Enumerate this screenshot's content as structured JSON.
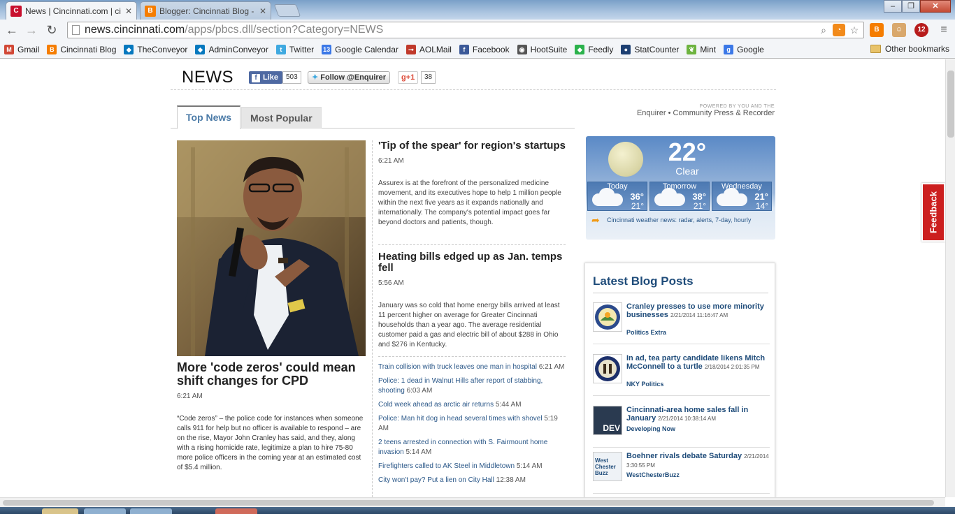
{
  "browser": {
    "tabs": [
      {
        "label": "News | Cincinnati.com | ci",
        "active": true,
        "icon": "C"
      },
      {
        "label": "Blogger: Cincinnati Blog -",
        "active": false,
        "icon": "B"
      }
    ],
    "url_host": "news.cincinnati.com",
    "url_path": "/apps/pbcs.dll/section?Category=NEWS",
    "extensions": [
      "blogger-icon",
      "avatar-icon",
      "abp-icon",
      "menu-icon"
    ],
    "abp_count": "12",
    "bookmarks": [
      {
        "label": "Gmail",
        "icon": "gmail-icon",
        "color": "#d14836",
        "glyph": "M"
      },
      {
        "label": "Cincinnati Blog",
        "icon": "blogger-icon",
        "color": "#f57d00",
        "glyph": "B"
      },
      {
        "label": "TheConveyor",
        "icon": "drupal-icon",
        "color": "#0678be",
        "glyph": "◆"
      },
      {
        "label": "AdminConveyor",
        "icon": "drupal-icon",
        "color": "#0678be",
        "glyph": "◆"
      },
      {
        "label": "Twitter",
        "icon": "twitter-icon",
        "color": "#3fa9e0",
        "glyph": "t"
      },
      {
        "label": "Google Calendar",
        "icon": "calendar-icon",
        "color": "#3b78e7",
        "glyph": "13"
      },
      {
        "label": "AOLMail",
        "icon": "key-icon",
        "color": "#c0392b",
        "glyph": "⊸"
      },
      {
        "label": "Facebook",
        "icon": "facebook-icon",
        "color": "#3b5998",
        "glyph": "f"
      },
      {
        "label": "HootSuite",
        "icon": "owl-icon",
        "color": "#555555",
        "glyph": "◉"
      },
      {
        "label": "Feedly",
        "icon": "feedly-icon",
        "color": "#2bb24c",
        "glyph": "◆"
      },
      {
        "label": "StatCounter",
        "icon": "statcounter-icon",
        "color": "#1d3f72",
        "glyph": "●"
      },
      {
        "label": "Mint",
        "icon": "mint-icon",
        "color": "#6db33f",
        "glyph": "❦"
      },
      {
        "label": "Google",
        "icon": "google-icon",
        "color": "#3b78e7",
        "glyph": "g"
      }
    ],
    "other_bookmarks": "Other bookmarks"
  },
  "header": {
    "section_title": "NEWS",
    "fb_like": "Like",
    "fb_count": "503",
    "twitter_follow": "Follow @Enquirer",
    "gplus": "+1",
    "gplus_count": "38"
  },
  "content_tabs": [
    "Top News",
    "Most Popular"
  ],
  "powered_by": {
    "small": "POWERED BY YOU AND THE",
    "brand": "Enquirer • Community Press & Recorder"
  },
  "hero": {
    "headline": "More 'code zeros' could mean shift changes for CPD",
    "time": "6:21 AM",
    "summary": "“Code zeros” – the police code for instances when someone calls 911 for help but no officer is available to respond – are on the rise, Mayor John Cranley has said, and they, along with a rising homicide rate, legitimize a plan to hire 75-80 more police officers in the coming year at an estimated cost of $5.4 million."
  },
  "stories": [
    {
      "headline": "'Tip of the spear' for region's startups",
      "time": "6:21 AM",
      "summary": "Assurex is at the forefront of the personalized medicine movement, and its executives hope to help 1 million people within the next five years as it expands nationally and internationally. The company's potential impact goes far beyond doctors and patients, though."
    },
    {
      "headline": "Heating bills edged up as Jan. temps fell",
      "time": "5:56 AM",
      "summary": "January was so cold that home energy bills arrived at least 11 percent higher on average for Greater Cincinnati households than a year ago. The average residential customer paid a gas and electric bill of about $288 in Ohio and $276 in Kentucky."
    }
  ],
  "links": [
    {
      "title": "Train collision with truck leaves one man in hospital",
      "time": "6:21 AM"
    },
    {
      "title": "Police: 1 dead in Walnut Hills after report of stabbing, shooting",
      "time": "6:03 AM"
    },
    {
      "title": "Cold week ahead as arctic air returns",
      "time": "5:44 AM"
    },
    {
      "title": "Police: Man hit dog in head several times with shovel",
      "time": "5:19 AM"
    },
    {
      "title": "2 teens arrested in connection with S. Fairmount home invasion",
      "time": "5:14 AM"
    },
    {
      "title": "Firefighters called to AK Steel in Middletown",
      "time": "5:14 AM"
    },
    {
      "title": "City won't pay? Put a lien on City Hall",
      "time": "12:38 AM"
    }
  ],
  "weather": {
    "current_temp": "22°",
    "condition": "Clear",
    "forecast": [
      {
        "day": "Today",
        "hi": "36°",
        "lo": "21°"
      },
      {
        "day": "Tomorrow",
        "hi": "38°",
        "lo": "21°"
      },
      {
        "day": "Wednesday",
        "hi": "21°",
        "lo": "14°"
      }
    ],
    "link": "Cincinnati weather news: radar, alerts, 7-day, hourly"
  },
  "blog": {
    "title": "Latest Blog Posts",
    "posts": [
      {
        "title": "Cranley presses to use more minority businesses",
        "stamp": "2/21/2014 11:16:47 AM",
        "source": "Politics Extra",
        "thumb": "seal-ohio"
      },
      {
        "title": "In ad, tea party candidate likens Mitch McConnell to a turtle",
        "stamp": "2/18/2014 2:01:35 PM",
        "source": "NKY Politics",
        "thumb": "seal-kentucky"
      },
      {
        "title": "Cincinnati-area home sales fall in January",
        "stamp": "2/21/2014 10:38:14 AM",
        "source": "Developing Now",
        "thumb": "DEV"
      },
      {
        "title": "Boehner rivals debate Saturday",
        "stamp": "2/21/2014 3:30:55 PM",
        "source": "WestChesterBuzz",
        "thumb": "West Chester Buzz"
      }
    ]
  },
  "feedback": "Feedback"
}
